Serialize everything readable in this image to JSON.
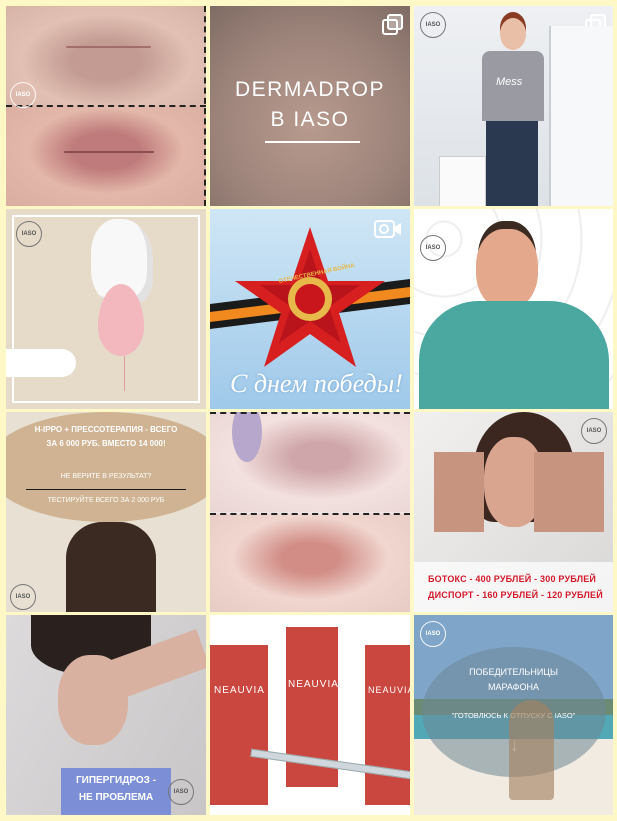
{
  "posts": [
    {
      "id": "lips-before-after",
      "logo": "IASO"
    },
    {
      "id": "dermadrop",
      "title_line1": "DERMADROP",
      "title_line2": "В IASO"
    },
    {
      "id": "patient-photo",
      "logo": "IASO",
      "shirt_text": "Mess"
    },
    {
      "id": "balloon-cream",
      "logo": "IASO"
    },
    {
      "id": "victory-day",
      "medal_text": "ОТЕЧЕСТВЕННАЯ ВОЙНА",
      "greeting": "С днем победы!"
    },
    {
      "id": "doctor-portrait",
      "logo": "IASO"
    },
    {
      "id": "hippo-offer",
      "line1": "H-IPPO + ПРЕССОТЕРАПИЯ - ВСЕГО",
      "line2": "ЗА 6 000 РУБ. ВМЕСТО 14 000!",
      "line3": "НЕ ВЕРИТЕ В РЕЗУЛЬТАТ?",
      "line4": "ТЕСТИРУЙТЕ ВСЕГО ЗА 2 000 РУБ",
      "logo": "IASO"
    },
    {
      "id": "lips-before-after-2"
    },
    {
      "id": "botox-prices",
      "price1": "БОТОКС - 400 РУБЛЕЙ - 300 РУБЛЕЙ",
      "price2": "ДИСПОРТ - 160 РУБЛЕЙ - 120 РУБЛЕЙ",
      "logo": "IASO"
    },
    {
      "id": "hyperhidrosis",
      "line1": "ГИПЕРГИДРОЗ -",
      "line2": "НЕ ПРОБЛЕМА",
      "logo": "IASO"
    },
    {
      "id": "neauvia",
      "brand1": "NEAUVIA",
      "brand2": "NEAUVIA",
      "brand3": "NEAUVIA"
    },
    {
      "id": "marathon",
      "line1": "ПОБЕДИТЕЛЬНИЦЫ",
      "line2": "МАРАФОНА",
      "line3": "\"ГОТОВЛЮСЬ К ОТПУСКУ С IASO\"",
      "logo": "IASO"
    }
  ],
  "colors": {
    "page_bg": "#fdf8c6",
    "price_red": "#d3192a"
  }
}
